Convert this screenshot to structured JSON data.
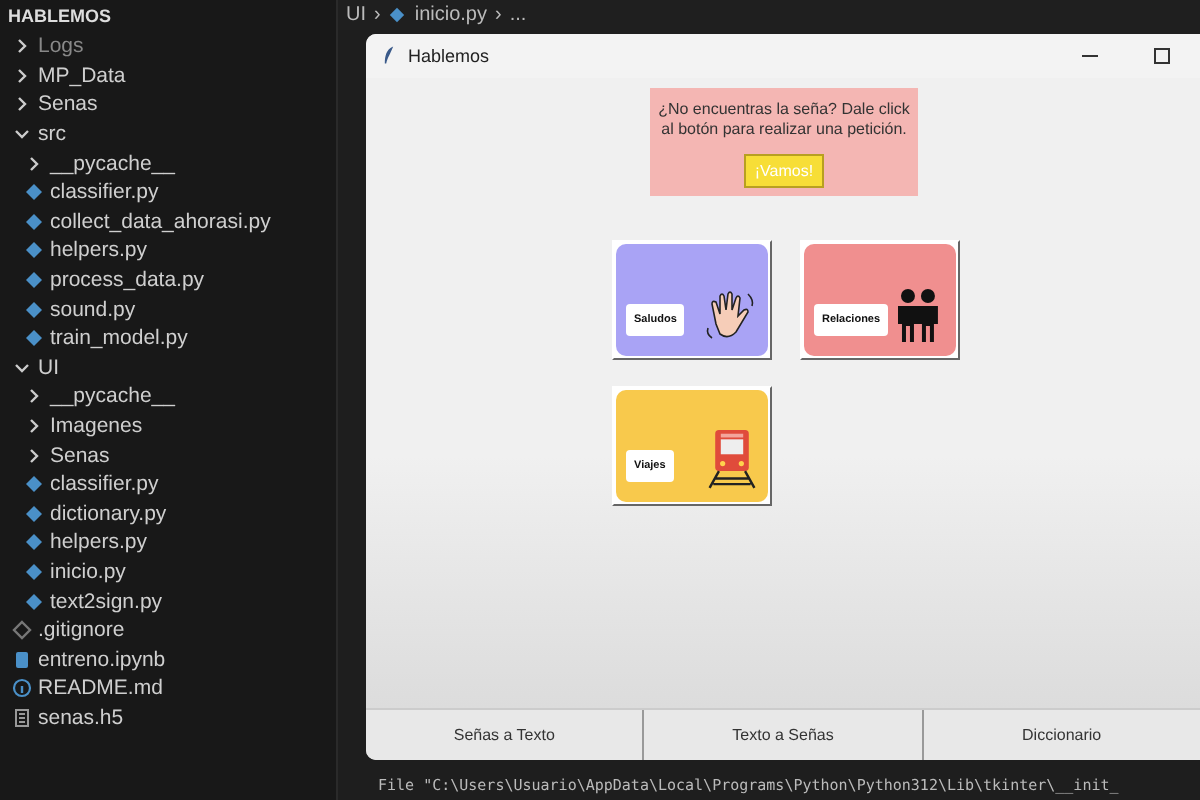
{
  "explorer": {
    "title": "HABLEMOS",
    "tree": [
      {
        "name": "Logs",
        "kind": "folder",
        "expanded": false,
        "dimmed": true
      },
      {
        "name": "MP_Data",
        "kind": "folder",
        "expanded": false,
        "dimmed": false
      },
      {
        "name": "Senas",
        "kind": "folder",
        "expanded": false,
        "dimmed": false
      },
      {
        "name": "src",
        "kind": "folder",
        "expanded": true,
        "dimmed": false,
        "children": [
          {
            "name": "__pycache__",
            "kind": "folder",
            "expanded": false,
            "dimmed": false
          },
          {
            "name": "classifier.py",
            "kind": "python",
            "dimmed": false
          },
          {
            "name": "collect_data_ahorasi.py",
            "kind": "python",
            "dimmed": false
          },
          {
            "name": "helpers.py",
            "kind": "python",
            "dimmed": false
          },
          {
            "name": "process_data.py",
            "kind": "python",
            "dimmed": false
          },
          {
            "name": "sound.py",
            "kind": "python",
            "dimmed": false
          },
          {
            "name": "train_model.py",
            "kind": "python",
            "dimmed": false
          }
        ]
      },
      {
        "name": "UI",
        "kind": "folder",
        "expanded": true,
        "dimmed": false,
        "children": [
          {
            "name": "__pycache__",
            "kind": "folder",
            "expanded": false,
            "dimmed": false
          },
          {
            "name": "Imagenes",
            "kind": "folder",
            "expanded": false,
            "dimmed": false
          },
          {
            "name": "Senas",
            "kind": "folder",
            "expanded": false,
            "dimmed": false
          },
          {
            "name": "classifier.py",
            "kind": "python",
            "dimmed": false
          },
          {
            "name": "dictionary.py",
            "kind": "python",
            "dimmed": false
          },
          {
            "name": "helpers.py",
            "kind": "python",
            "dimmed": false
          },
          {
            "name": "inicio.py",
            "kind": "python",
            "dimmed": false
          },
          {
            "name": "text2sign.py",
            "kind": "python",
            "dimmed": false
          }
        ]
      },
      {
        "name": ".gitignore",
        "kind": "git",
        "dimmed": false
      },
      {
        "name": "entreno.ipynb",
        "kind": "notebook",
        "dimmed": false
      },
      {
        "name": "README.md",
        "kind": "info",
        "dimmed": false
      },
      {
        "name": "senas.h5",
        "kind": "data",
        "dimmed": false
      }
    ]
  },
  "breadcrumb": [
    "UI",
    "›",
    "inicio.py",
    "›",
    "..."
  ],
  "terminal": {
    "lines": [
      "File \"C:\\Users\\Usuario\\AppData\\Local\\Programs\\Python\\Python312\\Lib\\tkinter\\__init_"
    ]
  },
  "app_window": {
    "title": "Hablemos",
    "request_box": {
      "message": "¿No encuentras la seña? Dale click al botón para realizar una petición.",
      "button": "¡Vamos!"
    },
    "categories": [
      {
        "label": "Saludos",
        "kind": "greeting",
        "color": "#a9a3f5"
      },
      {
        "label": "Relaciones",
        "kind": "people",
        "color": "#f08f8f"
      },
      {
        "label": "Viajes",
        "kind": "train",
        "color": "#f8c94c"
      }
    ],
    "bottom_tabs": [
      "Señas a Texto",
      "Texto a Señas",
      "Diccionario"
    ]
  }
}
